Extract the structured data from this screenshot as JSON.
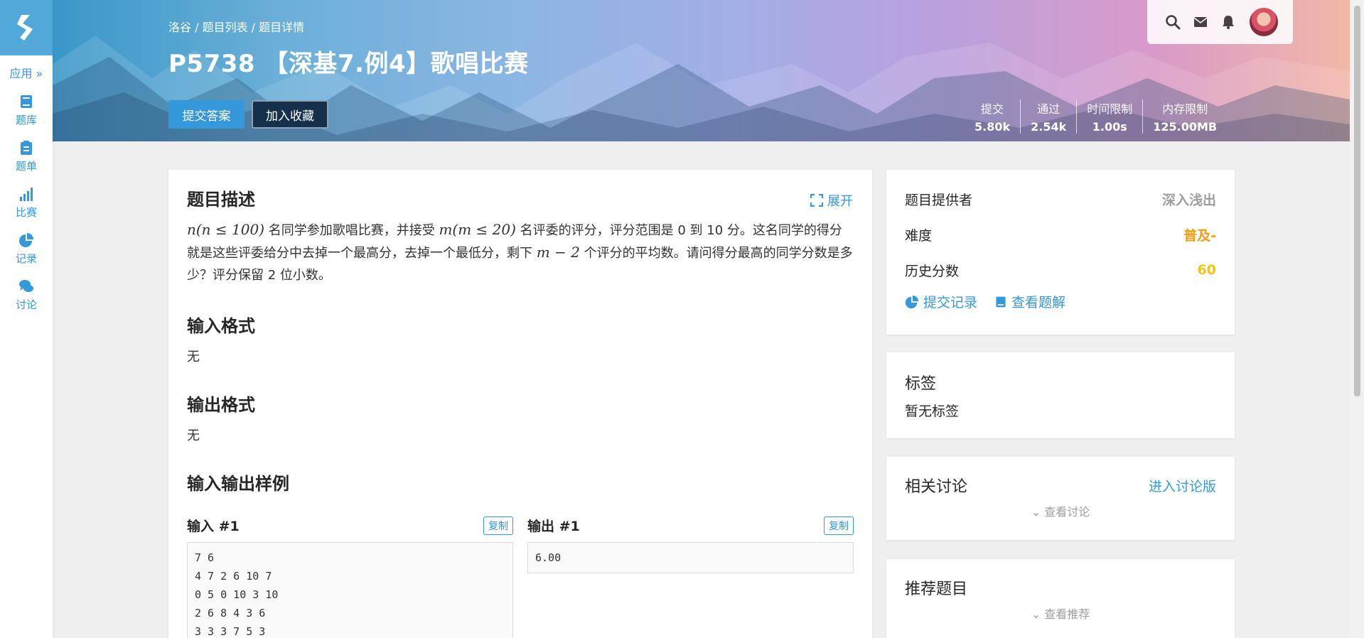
{
  "sidebar": {
    "apps_label": "应用 »",
    "items": [
      {
        "label": "题库",
        "icon": "book-icon"
      },
      {
        "label": "题单",
        "icon": "clipboard-icon"
      },
      {
        "label": "比赛",
        "icon": "bar-chart-icon"
      },
      {
        "label": "记录",
        "icon": "pie-chart-icon"
      },
      {
        "label": "讨论",
        "icon": "comments-icon"
      }
    ]
  },
  "header": {
    "breadcrumb": [
      "洛谷",
      "题目列表",
      "题目详情"
    ],
    "breadcrumb_sep": " / ",
    "title": "P5738 【深基7.例4】歌唱比赛",
    "submit_label": "提交答案",
    "favorite_label": "加入收藏",
    "stats": [
      {
        "label": "提交",
        "value": "5.80k"
      },
      {
        "label": "通过",
        "value": "2.54k"
      },
      {
        "label": "时间限制",
        "value": "1.00s"
      },
      {
        "label": "内存限制",
        "value": "125.00MB"
      }
    ]
  },
  "problem": {
    "desc_title": "题目描述",
    "expand_label": "展开",
    "desc_parts": {
      "m1": "n(n ≤ 100)",
      "t1": " 名同学参加歌唱比赛，并接受 ",
      "m2": "m(m ≤ 20)",
      "t2": " 名评委的评分，评分范围是 0 到 10 分。这名同学的得分就是这些评委给分中去掉一个最高分，去掉一个最低分，剩下 ",
      "m3": "m − 2",
      "t3": " 个评分的平均数。请问得分最高的同学分数是多少？评分保留 2 位小数。"
    },
    "input_title": "输入格式",
    "input_body": "无",
    "output_title": "输出格式",
    "output_body": "无",
    "samples_title": "输入输出样例",
    "sample_input_label": "输入 #1",
    "sample_output_label": "输出 #1",
    "copy_label": "复制",
    "sample_input": "7 6\n4 7 2 6 10 7\n0 5 0 10 3 10\n2 6 8 4 3 6\n3 3 3 7 5 3",
    "sample_output": "6.00"
  },
  "info": {
    "provider_label": "题目提供者",
    "provider_value": "深入浅出",
    "difficulty_label": "难度",
    "difficulty_value": "普及-",
    "history_label": "历史分数",
    "history_value": "60",
    "records_link": "提交记录",
    "solutions_link": "查看题解"
  },
  "tags": {
    "title": "标签",
    "empty": "暂无标签"
  },
  "discuss": {
    "title": "相关讨论",
    "enter_link": "进入讨论版",
    "more": "查看讨论"
  },
  "recommend": {
    "title": "推荐题目",
    "more": "查看推荐"
  },
  "colors": {
    "accent": "#3498db",
    "difficulty": "#f39c11",
    "score": "#f1c40f",
    "muted": "#9e9e9e"
  }
}
